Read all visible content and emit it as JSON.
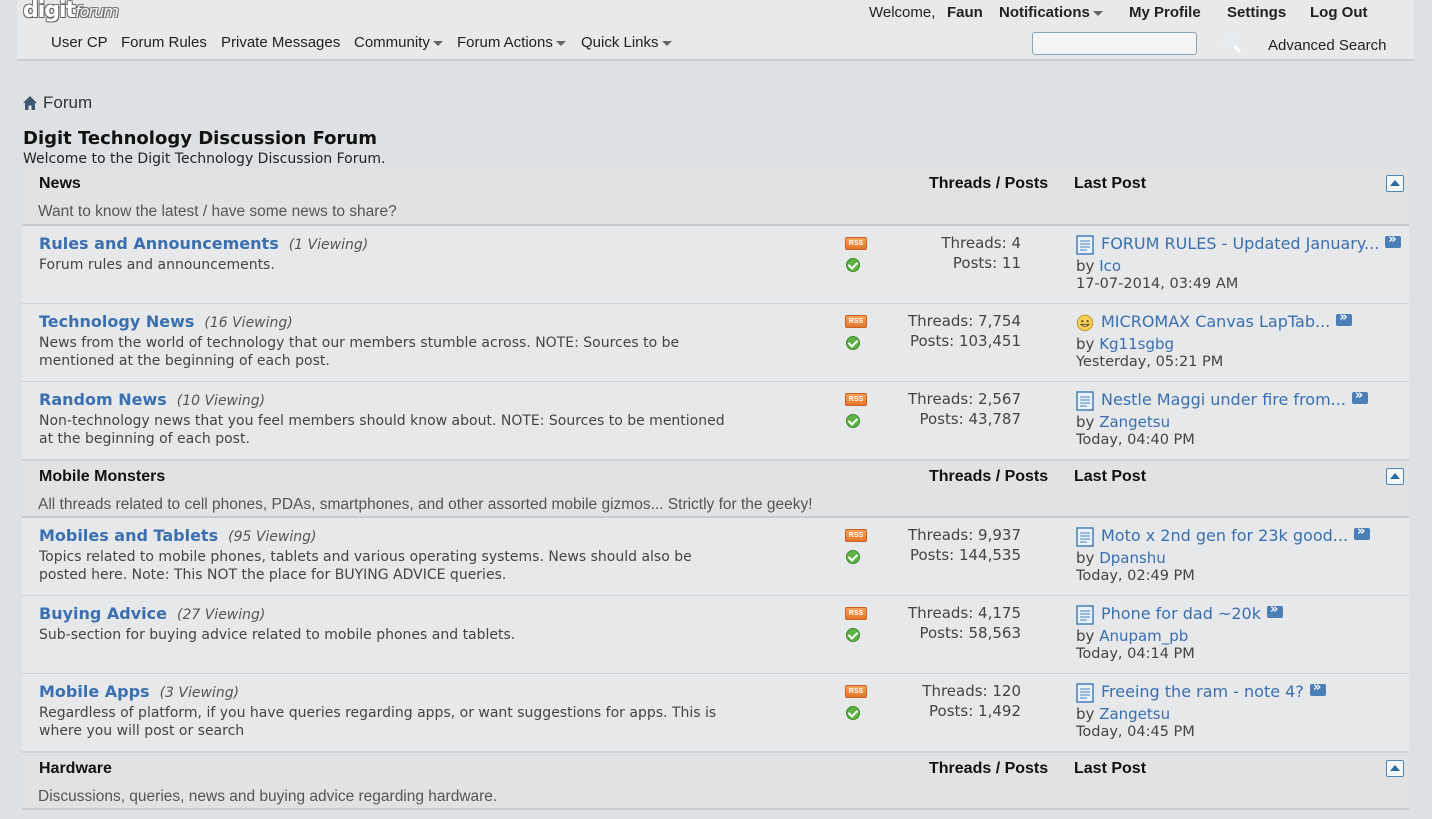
{
  "logo": {
    "main": "digit",
    "sub": "forum"
  },
  "userbar": {
    "welcome": "Welcome,",
    "username": "Faun",
    "notifications": "Notifications",
    "profile": "My Profile",
    "settings": "Settings",
    "logout": "Log Out"
  },
  "nav": {
    "user_cp": "User CP",
    "rules": "Forum Rules",
    "pm": "Private Messages",
    "community": "Community",
    "actions": "Forum Actions",
    "quick": "Quick Links"
  },
  "search": {
    "placeholder": "",
    "advanced": "Advanced Search"
  },
  "breadcrumb": {
    "label": "Forum"
  },
  "page": {
    "title": "Digit Technology Discussion Forum",
    "desc": "Welcome to the Digit Technology Discussion Forum."
  },
  "columns": {
    "tp": "Threads / Posts",
    "lp": "Last Post"
  },
  "categories": [
    {
      "title": "News",
      "desc": "Want to know the latest / have some news to share?",
      "forums": [
        {
          "name": "Rules and Announcements",
          "viewing": "(1 Viewing)",
          "desc": "Forum rules and announcements.",
          "threads": "Threads: 4",
          "posts": "Posts: 11",
          "lp_title": "FORUM RULES - Updated January...",
          "lp_by": "by",
          "lp_user": "Ico",
          "lp_date": "17-07-2014, 03:49 AM",
          "lp_icon": "document-icon"
        },
        {
          "name": "Technology News",
          "viewing": "(16 Viewing)",
          "desc": "News from the world of technology that our members stumble across. NOTE: Sources to be mentioned at the beginning of each post.",
          "threads": "Threads: 7,754",
          "posts": "Posts: 103,451",
          "lp_title": "MICROMAX Canvas LapTab...",
          "lp_by": "by",
          "lp_user": "Kg11sgbg",
          "lp_date": "Yesterday, 05:21 PM",
          "lp_icon": "smiley-icon"
        },
        {
          "name": "Random News",
          "viewing": "(10 Viewing)",
          "desc": "Non-technology news that you feel members should know about. NOTE: Sources to be mentioned at the beginning of each post.",
          "threads": "Threads: 2,567",
          "posts": "Posts: 43,787",
          "lp_title": "Nestle Maggi under fire from...",
          "lp_by": "by",
          "lp_user": "Zangetsu",
          "lp_date": "Today, 04:40 PM",
          "lp_icon": "document-icon"
        }
      ]
    },
    {
      "title": "Mobile Monsters",
      "desc": "All threads related to cell phones, PDAs, smartphones, and other assorted mobile gizmos... Strictly for the geeky!",
      "forums": [
        {
          "name": "Mobiles and Tablets",
          "viewing": "(95 Viewing)",
          "desc": "Topics related to mobile phones, tablets and various operating systems. News should also be posted here. Note: This NOT the place for BUYING ADVICE queries.",
          "threads": "Threads: 9,937",
          "posts": "Posts: 144,535",
          "lp_title": "Moto x 2nd gen for 23k good...",
          "lp_by": "by",
          "lp_user": "Dpanshu",
          "lp_date": "Today, 02:49 PM",
          "lp_icon": "document-icon"
        },
        {
          "name": "Buying Advice",
          "viewing": "(27 Viewing)",
          "desc": "Sub-section for buying advice related to mobile phones and tablets.",
          "threads": "Threads: 4,175",
          "posts": "Posts: 58,563",
          "lp_title": "Phone for dad ~20k",
          "lp_by": "by",
          "lp_user": "Anupam_pb",
          "lp_date": "Today, 04:14 PM",
          "lp_icon": "document-icon"
        },
        {
          "name": "Mobile Apps",
          "viewing": "(3 Viewing)",
          "desc": "Regardless of platform, if you have queries regarding apps, or want suggestions for apps. This is where you will post or search",
          "threads": "Threads: 120",
          "posts": "Posts: 1,492",
          "lp_title": "Freeing the ram - note 4?",
          "lp_by": "by",
          "lp_user": "Zangetsu",
          "lp_date": "Today, 04:45 PM",
          "lp_icon": "document-icon"
        }
      ]
    },
    {
      "title": "Hardware",
      "desc": "Discussions, queries, news and buying advice regarding hardware.",
      "forums": []
    }
  ]
}
